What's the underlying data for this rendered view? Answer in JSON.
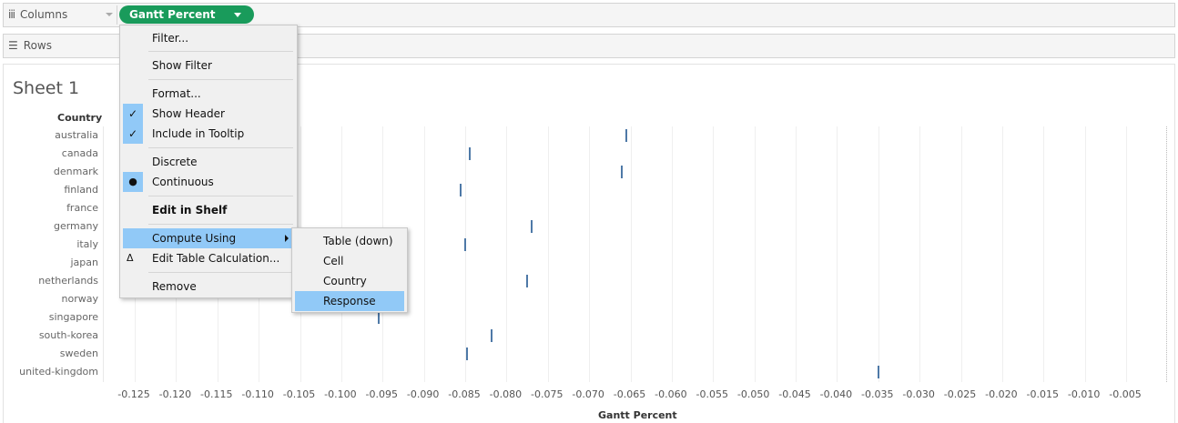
{
  "columns_shelf": {
    "label": "Columns",
    "icon": "columns-icon",
    "pill": "Gantt Percent"
  },
  "rows_shelf": {
    "label": "Rows",
    "icon": "rows-icon"
  },
  "sheet": {
    "title": "Sheet 1",
    "row_header": "Country"
  },
  "colors": {
    "pill": "#199b5b",
    "mark": "#4e79a7",
    "highlight": "#91c9f7"
  },
  "context_menu": {
    "items": [
      {
        "label": "Filter...",
        "icon": ""
      },
      {
        "label": "Show Filter",
        "icon": ""
      },
      {
        "label": "Format...",
        "icon": ""
      },
      {
        "label": "Show Header",
        "icon": "checkmark"
      },
      {
        "label": "Include in Tooltip",
        "icon": "checkmark"
      },
      {
        "label": "Discrete",
        "icon": ""
      },
      {
        "label": "Continuous",
        "icon": "bullet"
      },
      {
        "label": "Edit in Shelf",
        "icon": ""
      },
      {
        "label": "Compute Using",
        "icon": "submenu-arrow"
      },
      {
        "label": "Edit Table Calculation...",
        "icon": "delta"
      },
      {
        "label": "Remove",
        "icon": ""
      }
    ],
    "glyphs": {
      "check": "✓",
      "bullet": "●",
      "delta": "Δ"
    }
  },
  "submenu": {
    "items": [
      "Table (down)",
      "Cell",
      "Country",
      "Response"
    ],
    "selected": "Response"
  },
  "chart_data": {
    "type": "gantt",
    "xlabel": "Gantt Percent",
    "ylabel": "Country",
    "xlim": [
      -0.13,
      0.0
    ],
    "x_ticks": [
      "-0.125",
      "-0.120",
      "-0.115",
      "-0.110",
      "-0.105",
      "-0.100",
      "-0.095",
      "-0.090",
      "-0.085",
      "-0.080",
      "-0.075",
      "-0.070",
      "-0.065",
      "-0.060",
      "-0.055",
      "-0.050",
      "-0.045",
      "-0.040",
      "-0.035",
      "-0.030",
      "-0.025",
      "-0.020",
      "-0.015",
      "-0.010",
      "-0.005"
    ],
    "categories": [
      "australia",
      "canada",
      "denmark",
      "finland",
      "france",
      "germany",
      "italy",
      "japan",
      "netherlands",
      "norway",
      "singapore",
      "south-korea",
      "sweden",
      "united-kingdom"
    ],
    "values": [
      -0.0655,
      -0.0845,
      -0.066,
      -0.0855,
      null,
      -0.077,
      -0.085,
      null,
      -0.0775,
      null,
      -0.0955,
      -0.0818,
      -0.0848,
      -0.035
    ]
  }
}
